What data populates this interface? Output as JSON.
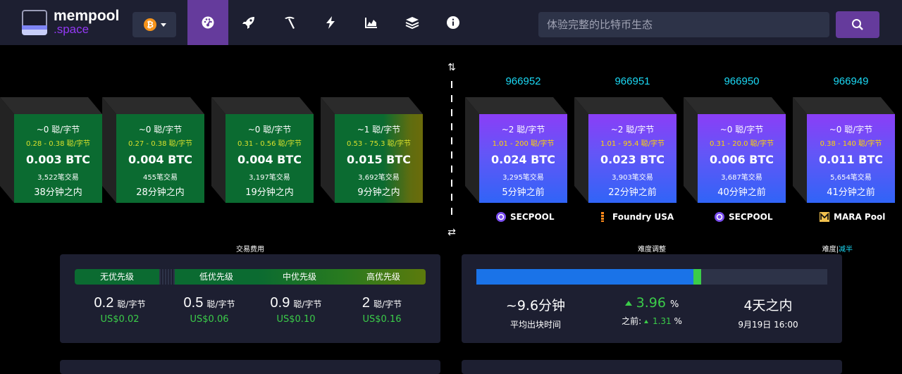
{
  "header": {
    "brand_line1": "mempool",
    "brand_line2": ".space",
    "coin_symbol": "₿",
    "search_placeholder": "体验完整的比特币生态",
    "nav_icons": [
      "dashboard-icon",
      "rocket-icon",
      "pickaxe-icon",
      "lightning-icon",
      "chart-icon",
      "layers-icon",
      "info-icon"
    ]
  },
  "mempool_blocks": [
    {
      "fee": "~0 聪/字节",
      "range": "0.28 - 0.38 聪/字节",
      "btc": "0.003 BTC",
      "tx": "3,522笔交易",
      "time": "38分钟之内"
    },
    {
      "fee": "~0 聪/字节",
      "range": "0.27 - 0.38 聪/字节",
      "btc": "0.004 BTC",
      "tx": "455笔交易",
      "time": "28分钟之内"
    },
    {
      "fee": "~0 聪/字节",
      "range": "0.31 - 0.56 聪/字节",
      "btc": "0.004 BTC",
      "tx": "3,197笔交易",
      "time": "19分钟之内"
    },
    {
      "fee": "~1 聪/字节",
      "range": "0.53 - 75.3 聪/字节",
      "btc": "0.015 BTC",
      "tx": "3,692笔交易",
      "time": "9分钟之内"
    }
  ],
  "mined_blocks": [
    {
      "height": "966952",
      "fee": "~2 聪/字节",
      "range": "1.01 - 200 聪/字节",
      "btc": "0.024 BTC",
      "tx": "3,295笔交易",
      "time": "5分钟之前",
      "pool": "SECPOOL"
    },
    {
      "height": "966951",
      "fee": "~2 聪/字节",
      "range": "1.01 - 95.4 聪/字节",
      "btc": "0.023 BTC",
      "tx": "3,903笔交易",
      "time": "22分钟之前",
      "pool": "Foundry USA"
    },
    {
      "height": "966950",
      "fee": "~0 聪/字节",
      "range": "0.31 - 20.0 聪/字节",
      "btc": "0.006 BTC",
      "tx": "3,687笔交易",
      "time": "40分钟之前",
      "pool": "SECPOOL"
    },
    {
      "height": "966949",
      "fee": "~0 聪/字节",
      "range": "0.38 - 140 聪/字节",
      "btc": "0.011 BTC",
      "tx": "5,654笔交易",
      "time": "41分钟之前",
      "pool": "MARA Pool"
    }
  ],
  "fees": {
    "title": "交易费用",
    "labels": [
      "无优先级",
      "低优先级",
      "中优先级",
      "高优先级"
    ],
    "values": [
      {
        "val": "0.2",
        "unit": "聪/字节",
        "usd": "US$0.02"
      },
      {
        "val": "0.5",
        "unit": "聪/字节",
        "usd": "US$0.06"
      },
      {
        "val": "0.9",
        "unit": "聪/字节",
        "usd": "US$0.10"
      },
      {
        "val": "2",
        "unit": "聪/字节",
        "usd": "US$0.16"
      }
    ]
  },
  "difficulty": {
    "title": "难度调整",
    "toggle_a": "难度",
    "toggle_sep": "|",
    "toggle_b": "减半",
    "progress_fraction": 0.618,
    "ahead_fraction": 0.022,
    "block_time": "~9.6分钟",
    "block_time_label": "平均出块时间",
    "change": "3.96",
    "change_unit": "%",
    "previous_label": "之前:",
    "previous": "1.31",
    "previous_unit": "%",
    "eta": "4天之内",
    "eta_date": "9月19日 16:00"
  },
  "colors": {
    "accent": "#653b9c",
    "green": "#3bcc49",
    "height": "#1bd8f4"
  }
}
